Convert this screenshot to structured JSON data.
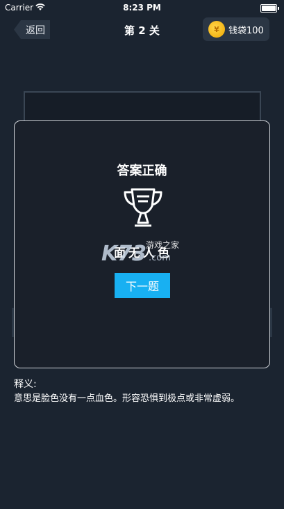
{
  "status_bar": {
    "carrier": "Carrier",
    "time": "8:23 PM"
  },
  "nav": {
    "back_label": "返回",
    "title": "第 2 关",
    "wallet_label": "钱袋100",
    "coin_symbol": "¥"
  },
  "dialog": {
    "title": "答案正确",
    "answer": "面无人色",
    "watermark_text": "K73",
    "watermark_site": "游戏之家",
    "watermark_domain": ".com",
    "next_label": "下一题"
  },
  "explanation": {
    "label": "释义:",
    "text": "意思是脸色没有一点血色。形容恐惧到极点或非常虚弱。"
  }
}
